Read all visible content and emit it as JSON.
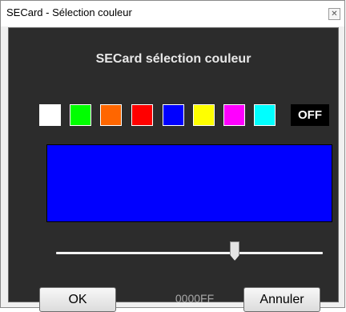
{
  "window": {
    "title": "SECard - Sélection couleur",
    "close_glyph": "✕"
  },
  "dialog": {
    "heading": "SECard sélection couleur",
    "swatches": [
      {
        "name": "white",
        "color": "#ffffff"
      },
      {
        "name": "green",
        "color": "#00ff00"
      },
      {
        "name": "orange",
        "color": "#ff6600"
      },
      {
        "name": "red",
        "color": "#ff0000"
      },
      {
        "name": "blue",
        "color": "#0000ff"
      },
      {
        "name": "yellow",
        "color": "#ffff00"
      },
      {
        "name": "magenta",
        "color": "#ff00ff"
      },
      {
        "name": "cyan",
        "color": "#00ffff"
      }
    ],
    "off_label": "OFF",
    "preview_color": "#0000ff",
    "slider_value": 0.67,
    "hex_value": "0000FF",
    "ok_label": "OK",
    "cancel_label": "Annuler"
  }
}
